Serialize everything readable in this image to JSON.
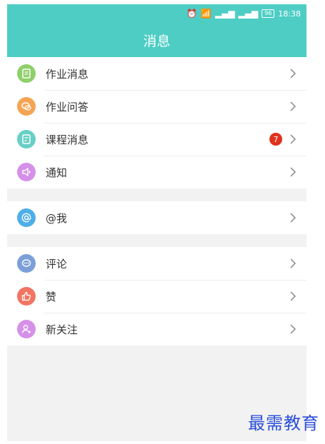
{
  "status_bar": {
    "time": "18:38",
    "battery": "96",
    "icons": [
      "alarm-icon",
      "wifi-icon",
      "signal-icon",
      "signal-icon",
      "battery-icon"
    ]
  },
  "header": {
    "title": "消息"
  },
  "groups": [
    {
      "items": [
        {
          "label": "作业消息",
          "icon": "homework-icon",
          "color": "#8fcf6a"
        },
        {
          "label": "作业问答",
          "icon": "chat-bubble-icon",
          "color": "#f5a454"
        },
        {
          "label": "课程消息",
          "icon": "course-icon",
          "color": "#67cfc6",
          "badge": "7"
        },
        {
          "label": "通知",
          "icon": "speaker-icon",
          "color": "#d590e8"
        }
      ]
    },
    {
      "items": [
        {
          "label": "@我",
          "icon": "at-icon",
          "color": "#4eaee8"
        }
      ]
    },
    {
      "items": [
        {
          "label": "评论",
          "icon": "comment-icon",
          "color": "#7b9fd8"
        },
        {
          "label": "赞",
          "icon": "thumbs-up-icon",
          "color": "#f27462"
        },
        {
          "label": "新关注",
          "icon": "add-user-icon",
          "color": "#d590e8"
        }
      ]
    }
  ],
  "watermark": "最需教育",
  "colors": {
    "accent": "#4ecdc4",
    "badge": "#e0321e"
  }
}
